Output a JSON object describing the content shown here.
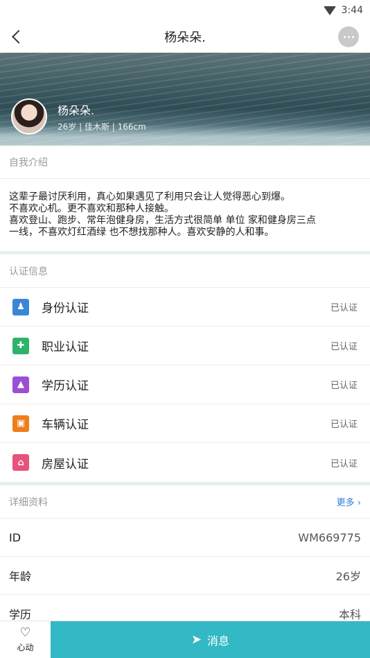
{
  "status_bar": {
    "time": "3:44"
  },
  "header": {
    "title": "杨朵朵."
  },
  "profile": {
    "name": "杨朵朵.",
    "meta": "26岁 | 佳木斯 | 166cm"
  },
  "intro": {
    "heading": "自我介绍",
    "lines": [
      "这辈子最讨厌利用，真心如果遇见了利用只会让人觉得恶心到爆。",
      "不喜欢心机。更不喜欢和那种人接触。",
      "喜欢登山、跑步、常年泡健身房，生活方式很简单 单位 家和健身房三点",
      "一线，不喜欢灯红酒绿 也不想找那种人。喜欢安静的人和事。"
    ]
  },
  "certification": {
    "heading": "认证信息",
    "items": [
      {
        "label": "身份认证",
        "status": "已认证",
        "icon": "id-card-icon",
        "color": "#3a86d6"
      },
      {
        "label": "职业认证",
        "status": "已认证",
        "icon": "briefcase-icon",
        "color": "#2fb36a"
      },
      {
        "label": "学历认证",
        "status": "已认证",
        "icon": "graduation-cap-icon",
        "color": "#9b4fd6"
      },
      {
        "label": "车辆认证",
        "status": "已认证",
        "icon": "car-icon",
        "color": "#ef7d1c"
      },
      {
        "label": "房屋认证",
        "status": "已认证",
        "icon": "house-icon",
        "color": "#e8537a"
      }
    ]
  },
  "details": {
    "heading": "详细资料",
    "more": "更多",
    "rows": [
      {
        "label": "ID",
        "value": "WM669775"
      },
      {
        "label": "年龄",
        "value": "26岁"
      },
      {
        "label": "学历",
        "value": "本科"
      }
    ]
  },
  "bottom_bar": {
    "like_label": "心动",
    "message_label": "消息",
    "accent": "#33b8c5"
  }
}
